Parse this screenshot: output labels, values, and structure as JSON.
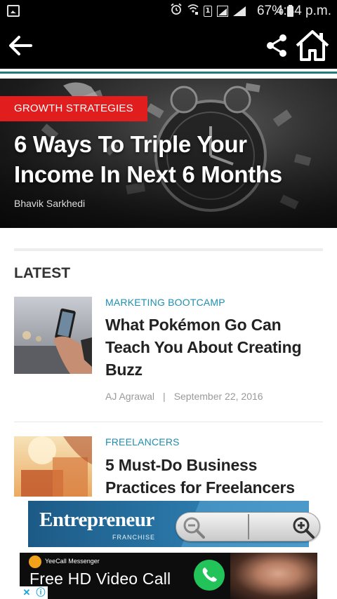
{
  "status_bar": {
    "battery": "67%",
    "time": "4:34 p.m.",
    "icons": [
      "image-notification-icon",
      "alarm-icon",
      "wifi-icon",
      "sim-1-icon",
      "signal-box-icon",
      "signal-bars-icon",
      "battery-icon"
    ],
    "sim_label": "1"
  },
  "toolbar": {
    "icons": [
      "back-arrow-icon",
      "share-icon",
      "home-icon"
    ],
    "accent_color": "#1f7c7a"
  },
  "hero": {
    "category": "GROWTH STRATEGIES",
    "title": "6 Ways To Triple Your Income In Next 6 Months",
    "author": "Bhavik Sarkhedi",
    "category_color": "#e21d1d"
  },
  "latest": {
    "heading": "LATEST",
    "articles": [
      {
        "category": "MARKETING BOOTCAMP",
        "title": "What Pokémon Go Can Teach You About Creating Buzz",
        "author": "AJ Agrawal",
        "separator": "|",
        "date": "September 22, 2016"
      },
      {
        "category": "FREELANCERS",
        "title": "5 Must-Do Business Practices for Freelancers",
        "author": "",
        "date": ""
      }
    ],
    "category_color": "#1e8fb0"
  },
  "ads": {
    "ad1": {
      "brand": "Entrepreneur",
      "sub": "FRANCHISE"
    },
    "zoom": {
      "icons": [
        "zoom-out-icon",
        "zoom-in-icon"
      ]
    },
    "ad2": {
      "app_name": "YeeCall Messenger",
      "headline": "Free HD Video Call",
      "call_icon": "phone-icon",
      "call_color": "#22c45a"
    },
    "adchoices": {
      "close_glyph": "✕",
      "info_glyph": "ⓘ"
    }
  }
}
